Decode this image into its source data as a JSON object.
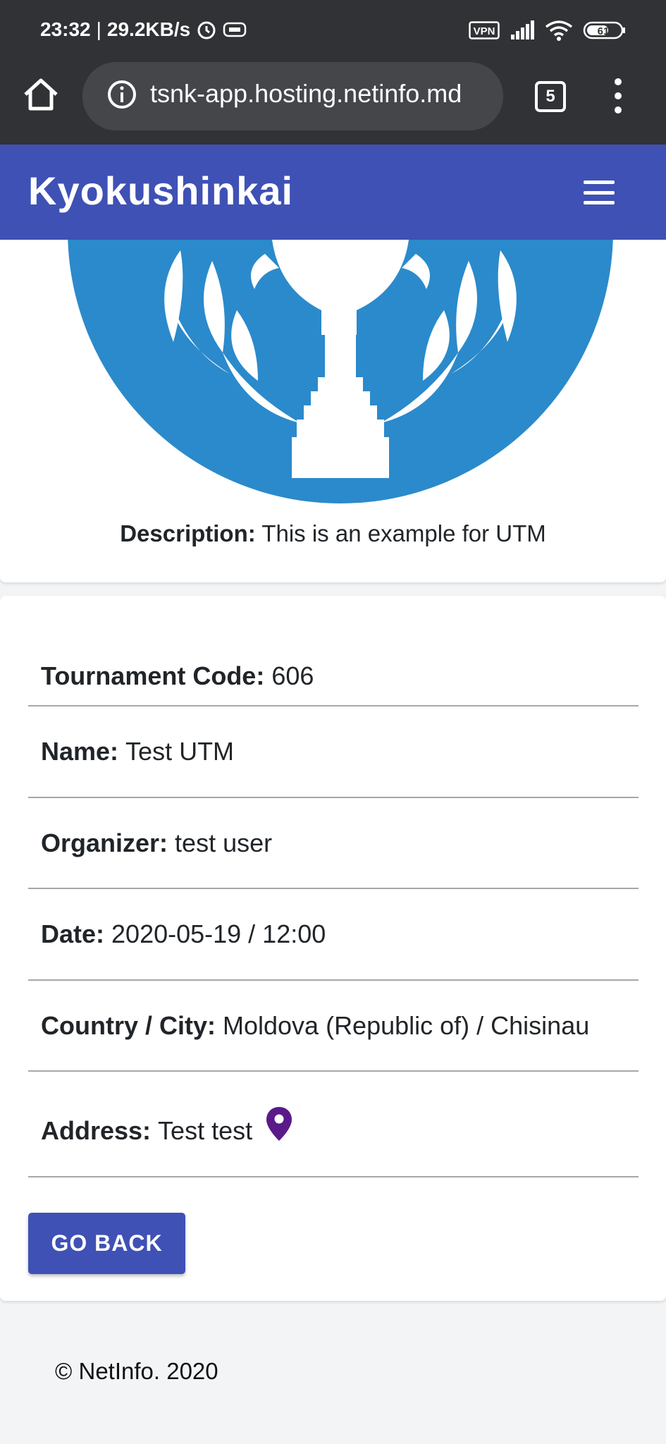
{
  "status_bar": {
    "time": "23:32",
    "separator": "|",
    "network_speed": "29.2KB/s",
    "vpn_label": "VPN",
    "battery": "61",
    "icons": [
      "alarm-icon",
      "hd-icon",
      "vpn-icon",
      "signal-icon",
      "wifi-icon",
      "battery-icon"
    ]
  },
  "browser": {
    "url": "tsnk-app.hosting.netinfo.md",
    "tab_count": "5",
    "icons": [
      "home-icon",
      "info-icon",
      "tabs-icon",
      "more-vert-icon"
    ]
  },
  "app_bar": {
    "title": "Kyokushinkai",
    "menu_icon": "hamburger-menu-icon"
  },
  "tournament": {
    "logo_icon": "trophy-laurel-logo",
    "description_label": "Description:",
    "description_value": "This is an example for UTM",
    "details": [
      {
        "label": "Tournament Code:",
        "value": "606"
      },
      {
        "label": "Name:",
        "value": "Test UTM"
      },
      {
        "label": "Organizer:",
        "value": "test user"
      },
      {
        "label": "Date:",
        "value": "2020-05-19 / 12:00"
      },
      {
        "label": "Country / City:",
        "value": "Moldova (Republic of) / Chisinau"
      },
      {
        "label": "Address:",
        "value": "Test test"
      }
    ],
    "go_back_label": "GO BACK"
  },
  "footer": {
    "copyright": "© NetInfo. 2020"
  },
  "colors": {
    "primary": "#3f51b5",
    "logo_blue": "#2b8acb",
    "pin_purple": "#5a1a8a",
    "status_bar": "#313235"
  }
}
